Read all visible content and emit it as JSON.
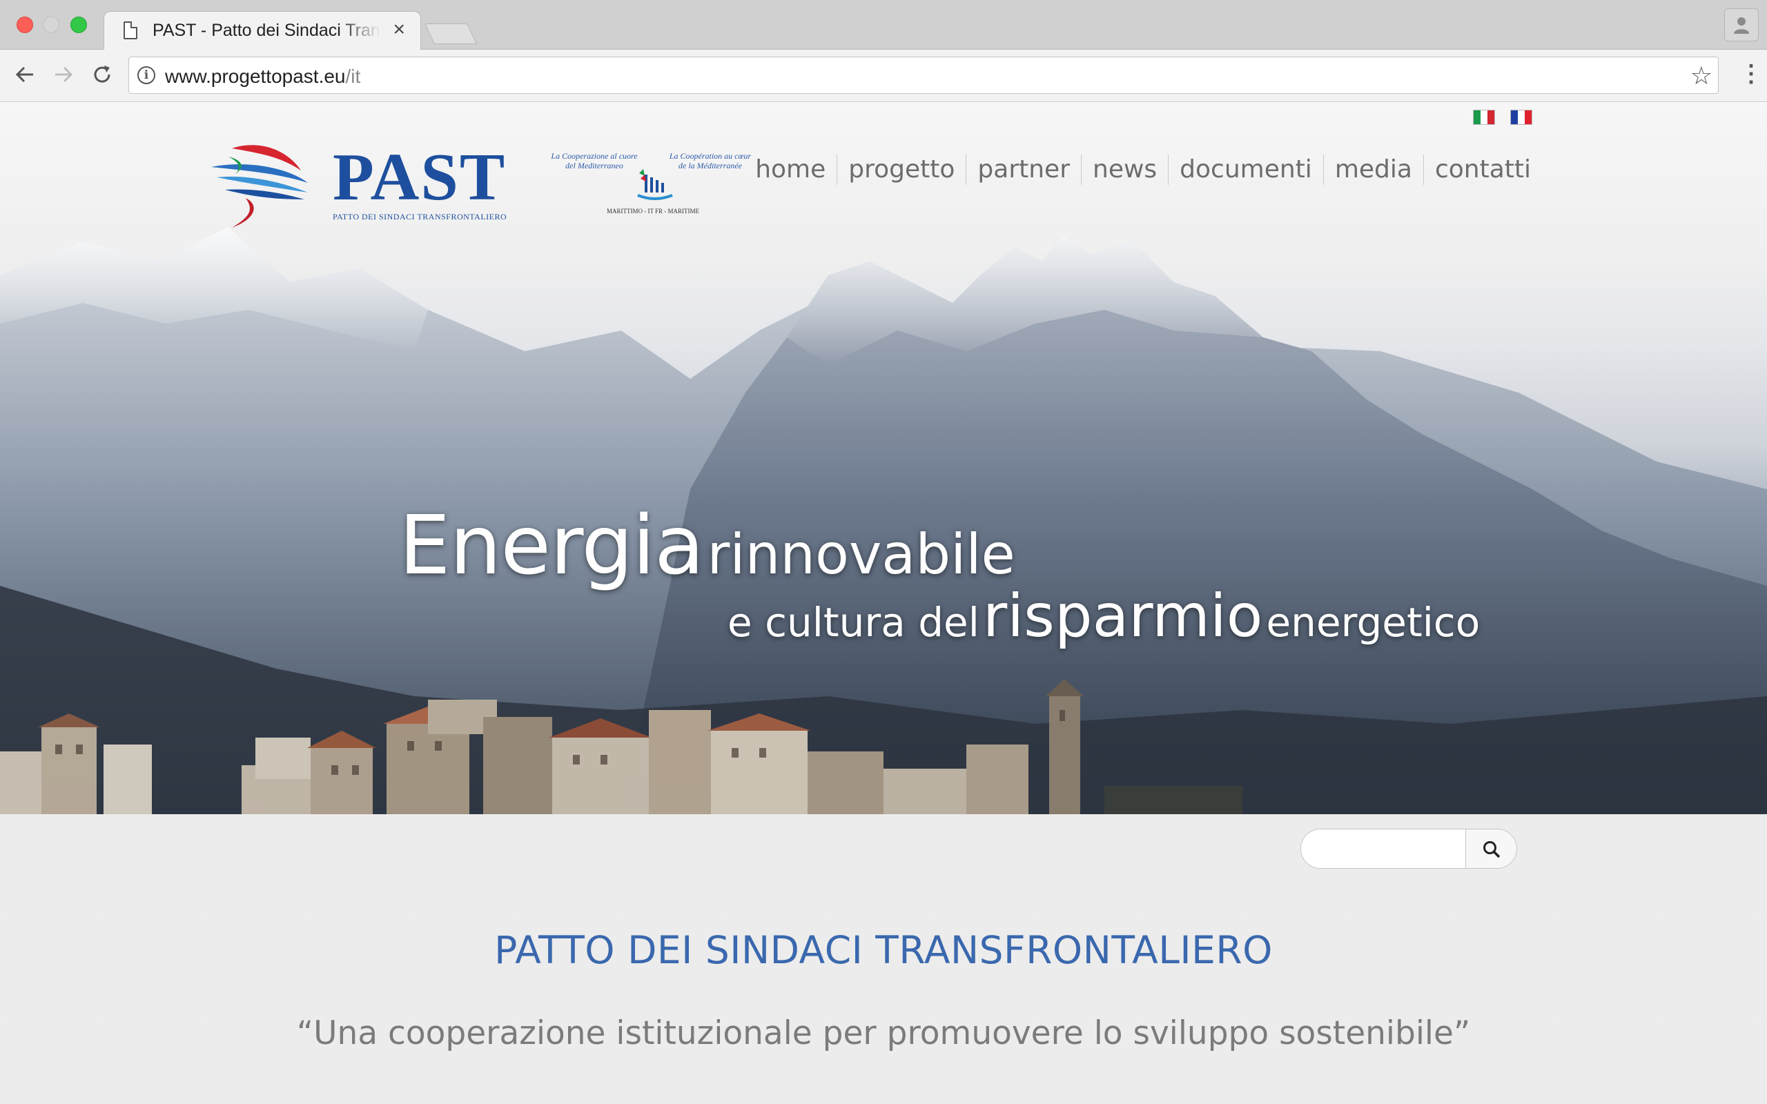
{
  "browser": {
    "tab_title": "PAST - Patto dei Sindaci Transfrontaliero",
    "tab_close": "×",
    "url_host": "www.progettopast.eu",
    "url_path": "/it"
  },
  "header": {
    "logo_text": "PAST",
    "logo_subtitle": "PATTO DEI SINDACI TRANSFRONTALIERO",
    "partner_text_left": "La Cooperazione al cuore del Mediterraneo",
    "partner_text_right": "La Coopération au cœur de la Méditerranée",
    "partner_caption": "MARITTIMO - IT FR - MARITIME",
    "languages": [
      "it",
      "fr"
    ]
  },
  "menu": {
    "items": [
      {
        "label": "home"
      },
      {
        "label": "progetto"
      },
      {
        "label": "partner"
      },
      {
        "label": "news"
      },
      {
        "label": "documenti"
      },
      {
        "label": "media"
      },
      {
        "label": "contatti"
      }
    ]
  },
  "hero": {
    "line1_big": "Energia",
    "line1_rest": "rinnovabile",
    "line2_a": "e cultura del",
    "line2_big": "risparmio",
    "line2_b": "energetico"
  },
  "search": {
    "placeholder": "",
    "value": ""
  },
  "main": {
    "title": "PATTO DEI SINDACI TRANSFRONTALIERO",
    "subtitle": "“Una cooperazione istituzionale per promuovere lo sviluppo sostenibile”"
  },
  "colors": {
    "brand_blue": "#1e4f9e",
    "title_blue": "#3a68ae",
    "menu_gray": "#6c6c6c"
  }
}
